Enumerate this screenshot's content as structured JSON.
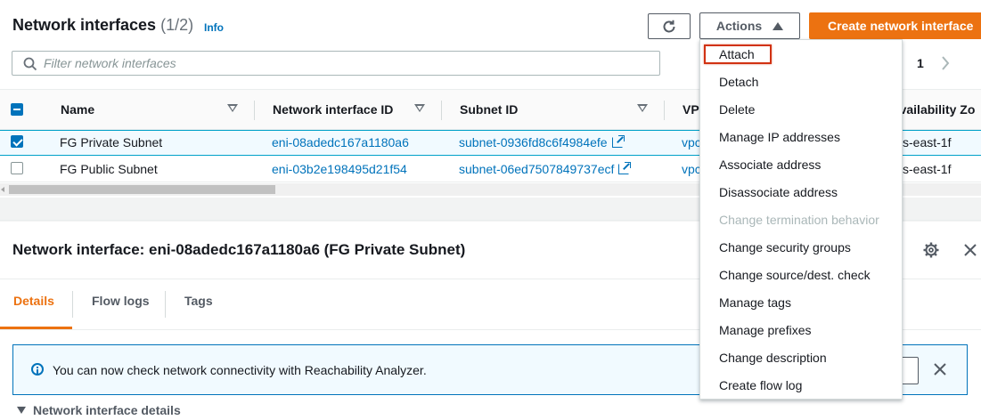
{
  "header": {
    "title": "Network interfaces",
    "count": "(1/2)",
    "info": "Info",
    "actions_label": "Actions",
    "create_label": "Create network interface",
    "filter_placeholder": "Filter network interfaces",
    "page_number": "1"
  },
  "table": {
    "columns": [
      "Name",
      "Network interface ID",
      "Subnet ID",
      "VPC",
      "Availability Zo"
    ],
    "rows": [
      {
        "selected": true,
        "name": "FG Private Subnet",
        "eni": "eni-08adedc167a1180a6",
        "subnet": "subnet-0936fd8c6f4984efe",
        "vpc": "vpc",
        "az": "s-east-1f"
      },
      {
        "selected": false,
        "name": "FG Public Subnet",
        "eni": "eni-03b2e198495d21f54",
        "subnet": "subnet-06ed7507849737ecf",
        "vpc": "vpc",
        "az": "s-east-1f"
      }
    ]
  },
  "details": {
    "title": "Network interface: eni-08adedc167a1180a6 (FG Private Subnet)",
    "tabs": [
      "Details",
      "Flow logs",
      "Tags"
    ],
    "alert_text": "You can now check network connectivity with Reachability Analyzer.",
    "section_label": "Network interface details"
  },
  "menu": {
    "items": [
      {
        "label": "Attach",
        "disabled": false
      },
      {
        "label": "Detach",
        "disabled": false
      },
      {
        "label": "Delete",
        "disabled": false
      },
      {
        "label": "Manage IP addresses",
        "disabled": false
      },
      {
        "label": "Associate address",
        "disabled": false
      },
      {
        "label": "Disassociate address",
        "disabled": false
      },
      {
        "label": "Change termination behavior",
        "disabled": true
      },
      {
        "label": "Change security groups",
        "disabled": false
      },
      {
        "label": "Change source/dest. check",
        "disabled": false
      },
      {
        "label": "Manage tags",
        "disabled": false
      },
      {
        "label": "Manage prefixes",
        "disabled": false
      },
      {
        "label": "Change description",
        "disabled": false
      },
      {
        "label": "Create flow log",
        "disabled": false
      }
    ]
  },
  "icons": {
    "refresh": "refresh-icon",
    "search": "search-icon",
    "settings": "gear-icon",
    "close": "close-icon",
    "info": "info-icon",
    "external": "external-link-icon"
  },
  "colors": {
    "accent": "#ec7211",
    "link": "#0073bb",
    "highlight": "#d13212"
  }
}
